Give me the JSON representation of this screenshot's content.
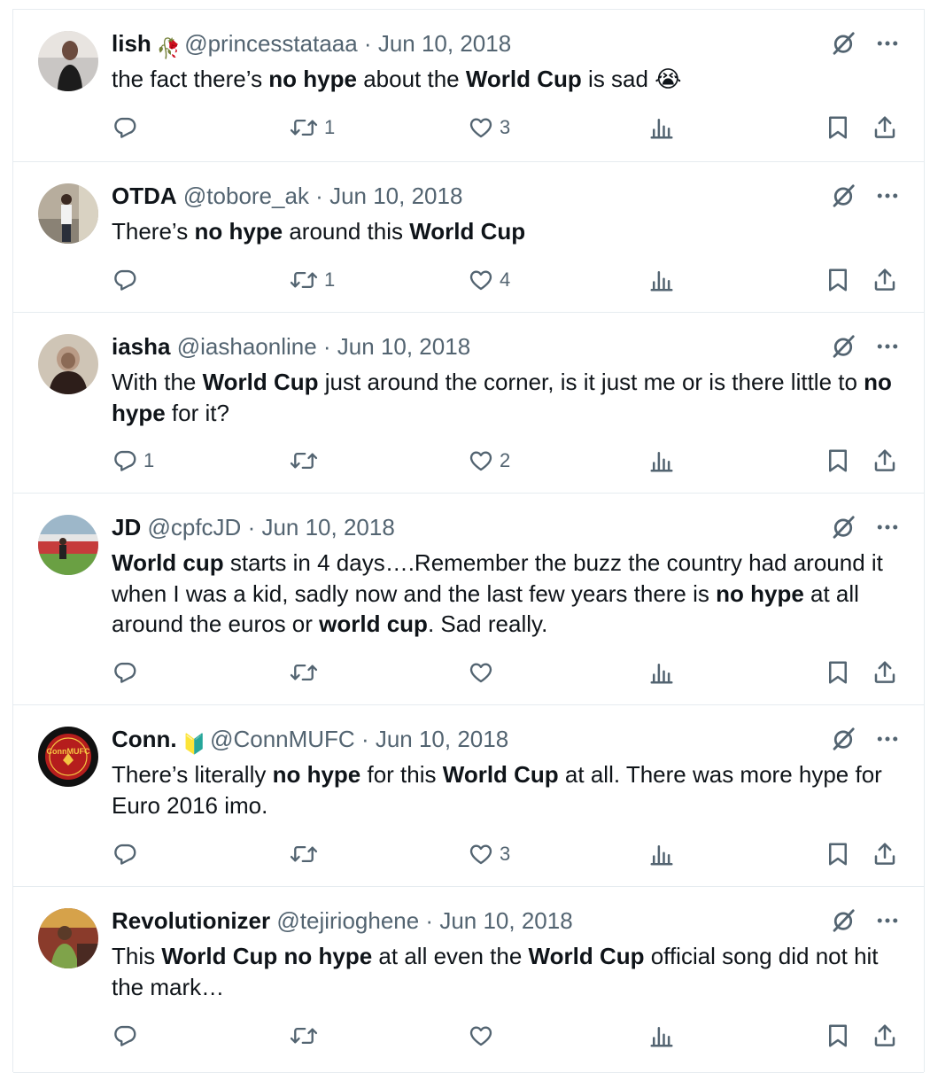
{
  "colors": {
    "text": "#0f1419",
    "muted": "#536471",
    "divider": "#e6ecf0"
  },
  "icons": {
    "reply": "reply-icon",
    "retweet": "retweet-icon",
    "like": "heart-icon",
    "views": "analytics-icon",
    "bookmark": "bookmark-icon",
    "share": "share-icon",
    "grok": "grok-icon",
    "more": "more-icon"
  },
  "tweets": [
    {
      "name": "lish",
      "badge": "🥀",
      "handle": "@princesstataaa",
      "date": "Jun 10, 2018",
      "segments": [
        {
          "t": "the fact there’s ",
          "b": false
        },
        {
          "t": "no hype",
          "b": true
        },
        {
          "t": " about the ",
          "b": false
        },
        {
          "t": "World Cup",
          "b": true
        },
        {
          "t": " is sad 😭",
          "b": false
        }
      ],
      "replies": "",
      "retweets": "1",
      "likes": "3"
    },
    {
      "name": "OTDA",
      "badge": "",
      "handle": "@tobore_ak",
      "date": "Jun 10, 2018",
      "segments": [
        {
          "t": "There’s ",
          "b": false
        },
        {
          "t": "no hype",
          "b": true
        },
        {
          "t": " around this ",
          "b": false
        },
        {
          "t": "World Cup",
          "b": true
        }
      ],
      "replies": "",
      "retweets": "1",
      "likes": "4"
    },
    {
      "name": "iasha",
      "badge": "",
      "handle": "@iashaonline",
      "date": "Jun 10, 2018",
      "segments": [
        {
          "t": "With the ",
          "b": false
        },
        {
          "t": "World Cup",
          "b": true
        },
        {
          "t": " just around the corner, is it just me or is there little to ",
          "b": false
        },
        {
          "t": "no hype",
          "b": true
        },
        {
          "t": " for it?",
          "b": false
        }
      ],
      "replies": "1",
      "retweets": "",
      "likes": "2"
    },
    {
      "name": "JD",
      "badge": "",
      "handle": "@cpfcJD",
      "date": "Jun 10, 2018",
      "segments": [
        {
          "t": "World cup",
          "b": true
        },
        {
          "t": " starts in 4 days….Remember the buzz the country had around it when I was a kid, sadly now and the last few years there is ",
          "b": false
        },
        {
          "t": "no hype",
          "b": true
        },
        {
          "t": " at all around the euros or ",
          "b": false
        },
        {
          "t": "world cup",
          "b": true
        },
        {
          "t": ". Sad really.",
          "b": false
        }
      ],
      "replies": "",
      "retweets": "",
      "likes": ""
    },
    {
      "name": "Conn.",
      "badge": "🔰",
      "handle": "@ConnMUFC",
      "date": "Jun 10, 2018",
      "avatar_text": "ConnMUFC",
      "segments": [
        {
          "t": "There’s literally ",
          "b": false
        },
        {
          "t": "no hype",
          "b": true
        },
        {
          "t": " for this ",
          "b": false
        },
        {
          "t": "World Cup",
          "b": true
        },
        {
          "t": " at all. There was more hype for Euro 2016 imo.",
          "b": false
        }
      ],
      "replies": "",
      "retweets": "",
      "likes": "3"
    },
    {
      "name": "Revolutionizer",
      "badge": "",
      "handle": "@tejirioghene",
      "date": "Jun 10, 2018",
      "segments": [
        {
          "t": "This ",
          "b": false
        },
        {
          "t": "World Cup",
          "b": true
        },
        {
          "t": " ",
          "b": false
        },
        {
          "t": "no hype",
          "b": true
        },
        {
          "t": " at all even the ",
          "b": false
        },
        {
          "t": "World Cup",
          "b": true
        },
        {
          "t": " official song did not hit the mark…",
          "b": false
        }
      ],
      "replies": "",
      "retweets": "",
      "likes": ""
    }
  ]
}
